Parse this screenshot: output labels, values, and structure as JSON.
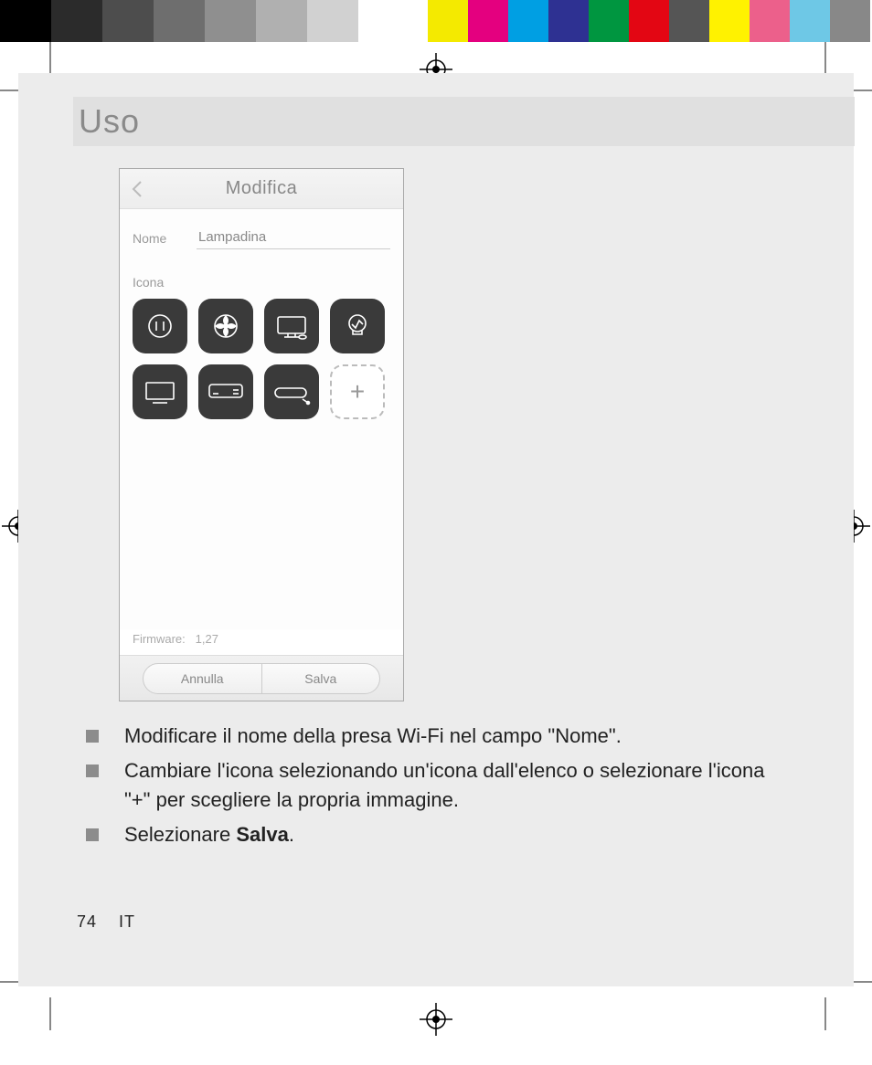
{
  "heading": "Uso",
  "phone": {
    "title": "Modifica",
    "name_label": "Nome",
    "name_value": "Lampadina",
    "icon_label": "Icona",
    "icons": [
      "outlet-icon",
      "fan-icon",
      "desktop-icon",
      "bulb-icon",
      "tv-icon",
      "ac-icon",
      "soundbar-icon"
    ],
    "firmware_label": "Firmware:",
    "firmware_value": "1,27",
    "cancel_label": "Annulla",
    "save_label": "Salva"
  },
  "bullets": [
    {
      "text": "Modificare il nome della presa Wi-Fi nel campo \"Nome\"."
    },
    {
      "text": "Cambiare l'icona selezionando un'icona dall'elenco o selezionare l'icona \"+\" per scegliere la propria immagine."
    },
    {
      "prefix": "Selezionare ",
      "bold": "Salva",
      "suffix": "."
    }
  ],
  "footer": {
    "page": "74",
    "lang": "IT"
  },
  "colorbar_left": [
    "#000000",
    "#2b2b2b",
    "#4d4d4d",
    "#6e6e6e",
    "#8f8f8f",
    "#b0b0b0",
    "#d1d1d1",
    "#ffffff"
  ],
  "colorbar_right": [
    "#f4ea00",
    "#e4007f",
    "#009fe3",
    "#2e3192",
    "#009640",
    "#e30613",
    "#555555",
    "#fff200",
    "#ec608b",
    "#6ec8e6",
    "#888888"
  ]
}
